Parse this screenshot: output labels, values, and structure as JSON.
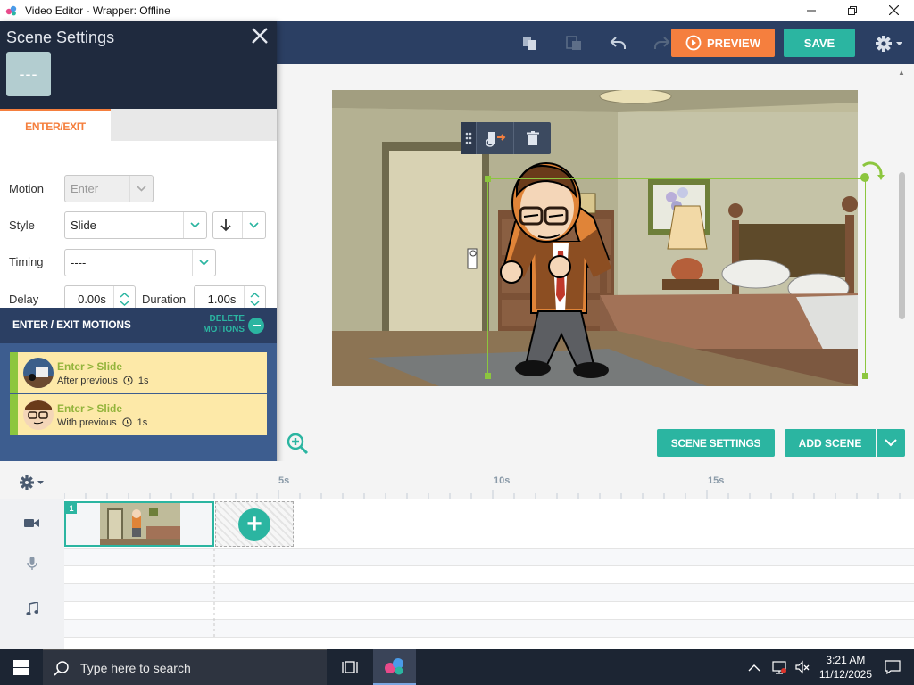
{
  "window": {
    "title": "Video Editor - Wrapper: Offline",
    "controls": [
      "minimize",
      "maximize",
      "close"
    ]
  },
  "toolbar": {
    "preview_label": "PREVIEW",
    "save_label": "SAVE",
    "icons": [
      "copy-icon",
      "paste-icon",
      "undo-icon",
      "redo-icon",
      "settings-gear-icon"
    ]
  },
  "scene_panel": {
    "title": "Scene Settings",
    "swatch_label": "---",
    "tabs": [
      {
        "label": "ENTER/EXIT",
        "active": true
      }
    ],
    "form": {
      "motion_label": "Motion",
      "motion_value": "Enter",
      "style_label": "Style",
      "style_value": "Slide",
      "timing_label": "Timing",
      "timing_value": "----",
      "delay_label": "Delay",
      "delay_value": "0.00s",
      "duration_label": "Duration",
      "duration_value": "1.00s"
    },
    "motions_title": "ENTER / EXIT MOTIONS",
    "delete_motions_label": "DELETE MOTIONS",
    "motions": [
      {
        "title": "Enter > Slide",
        "timing": "After previous",
        "duration": "1s"
      },
      {
        "title": "Enter > Slide",
        "timing": "With previous",
        "duration": "1s"
      }
    ]
  },
  "canvas": {
    "scene_settings_label": "SCENE SETTINGS",
    "add_scene_label": "ADD SCENE"
  },
  "timeline": {
    "ticks": [
      "5s",
      "10s",
      "15s"
    ],
    "scene_number": "1"
  },
  "taskbar": {
    "search_placeholder": "Type here to search",
    "time": "3:21 AM",
    "date": "11/12/2025"
  },
  "colors": {
    "accent_teal": "#2bb5a1",
    "accent_orange": "#f57f3e",
    "navy": "#2b3f63",
    "panel_blue": "#3d5d8f",
    "motion_bg": "#fde9a8",
    "selection_green": "#8cc63e"
  }
}
